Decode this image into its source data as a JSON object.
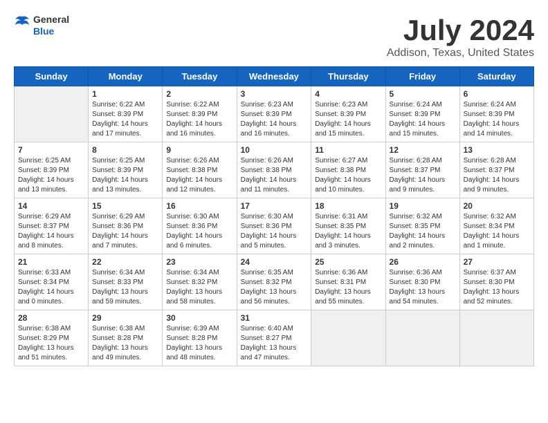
{
  "header": {
    "logo_general": "General",
    "logo_blue": "Blue",
    "month": "July 2024",
    "location": "Addison, Texas, United States"
  },
  "days_of_week": [
    "Sunday",
    "Monday",
    "Tuesday",
    "Wednesday",
    "Thursday",
    "Friday",
    "Saturday"
  ],
  "weeks": [
    [
      {
        "day": "",
        "info": ""
      },
      {
        "day": "1",
        "info": "Sunrise: 6:22 AM\nSunset: 8:39 PM\nDaylight: 14 hours\nand 17 minutes."
      },
      {
        "day": "2",
        "info": "Sunrise: 6:22 AM\nSunset: 8:39 PM\nDaylight: 14 hours\nand 16 minutes."
      },
      {
        "day": "3",
        "info": "Sunrise: 6:23 AM\nSunset: 8:39 PM\nDaylight: 14 hours\nand 16 minutes."
      },
      {
        "day": "4",
        "info": "Sunrise: 6:23 AM\nSunset: 8:39 PM\nDaylight: 14 hours\nand 15 minutes."
      },
      {
        "day": "5",
        "info": "Sunrise: 6:24 AM\nSunset: 8:39 PM\nDaylight: 14 hours\nand 15 minutes."
      },
      {
        "day": "6",
        "info": "Sunrise: 6:24 AM\nSunset: 8:39 PM\nDaylight: 14 hours\nand 14 minutes."
      }
    ],
    [
      {
        "day": "7",
        "info": "Sunrise: 6:25 AM\nSunset: 8:39 PM\nDaylight: 14 hours\nand 13 minutes."
      },
      {
        "day": "8",
        "info": "Sunrise: 6:25 AM\nSunset: 8:39 PM\nDaylight: 14 hours\nand 13 minutes."
      },
      {
        "day": "9",
        "info": "Sunrise: 6:26 AM\nSunset: 8:38 PM\nDaylight: 14 hours\nand 12 minutes."
      },
      {
        "day": "10",
        "info": "Sunrise: 6:26 AM\nSunset: 8:38 PM\nDaylight: 14 hours\nand 11 minutes."
      },
      {
        "day": "11",
        "info": "Sunrise: 6:27 AM\nSunset: 8:38 PM\nDaylight: 14 hours\nand 10 minutes."
      },
      {
        "day": "12",
        "info": "Sunrise: 6:28 AM\nSunset: 8:37 PM\nDaylight: 14 hours\nand 9 minutes."
      },
      {
        "day": "13",
        "info": "Sunrise: 6:28 AM\nSunset: 8:37 PM\nDaylight: 14 hours\nand 9 minutes."
      }
    ],
    [
      {
        "day": "14",
        "info": "Sunrise: 6:29 AM\nSunset: 8:37 PM\nDaylight: 14 hours\nand 8 minutes."
      },
      {
        "day": "15",
        "info": "Sunrise: 6:29 AM\nSunset: 8:36 PM\nDaylight: 14 hours\nand 7 minutes."
      },
      {
        "day": "16",
        "info": "Sunrise: 6:30 AM\nSunset: 8:36 PM\nDaylight: 14 hours\nand 6 minutes."
      },
      {
        "day": "17",
        "info": "Sunrise: 6:30 AM\nSunset: 8:36 PM\nDaylight: 14 hours\nand 5 minutes."
      },
      {
        "day": "18",
        "info": "Sunrise: 6:31 AM\nSunset: 8:35 PM\nDaylight: 14 hours\nand 3 minutes."
      },
      {
        "day": "19",
        "info": "Sunrise: 6:32 AM\nSunset: 8:35 PM\nDaylight: 14 hours\nand 2 minutes."
      },
      {
        "day": "20",
        "info": "Sunrise: 6:32 AM\nSunset: 8:34 PM\nDaylight: 14 hours\nand 1 minute."
      }
    ],
    [
      {
        "day": "21",
        "info": "Sunrise: 6:33 AM\nSunset: 8:34 PM\nDaylight: 14 hours\nand 0 minutes."
      },
      {
        "day": "22",
        "info": "Sunrise: 6:34 AM\nSunset: 8:33 PM\nDaylight: 13 hours\nand 59 minutes."
      },
      {
        "day": "23",
        "info": "Sunrise: 6:34 AM\nSunset: 8:32 PM\nDaylight: 13 hours\nand 58 minutes."
      },
      {
        "day": "24",
        "info": "Sunrise: 6:35 AM\nSunset: 8:32 PM\nDaylight: 13 hours\nand 56 minutes."
      },
      {
        "day": "25",
        "info": "Sunrise: 6:36 AM\nSunset: 8:31 PM\nDaylight: 13 hours\nand 55 minutes."
      },
      {
        "day": "26",
        "info": "Sunrise: 6:36 AM\nSunset: 8:30 PM\nDaylight: 13 hours\nand 54 minutes."
      },
      {
        "day": "27",
        "info": "Sunrise: 6:37 AM\nSunset: 8:30 PM\nDaylight: 13 hours\nand 52 minutes."
      }
    ],
    [
      {
        "day": "28",
        "info": "Sunrise: 6:38 AM\nSunset: 8:29 PM\nDaylight: 13 hours\nand 51 minutes."
      },
      {
        "day": "29",
        "info": "Sunrise: 6:38 AM\nSunset: 8:28 PM\nDaylight: 13 hours\nand 49 minutes."
      },
      {
        "day": "30",
        "info": "Sunrise: 6:39 AM\nSunset: 8:28 PM\nDaylight: 13 hours\nand 48 minutes."
      },
      {
        "day": "31",
        "info": "Sunrise: 6:40 AM\nSunset: 8:27 PM\nDaylight: 13 hours\nand 47 minutes."
      },
      {
        "day": "",
        "info": ""
      },
      {
        "day": "",
        "info": ""
      },
      {
        "day": "",
        "info": ""
      }
    ]
  ]
}
